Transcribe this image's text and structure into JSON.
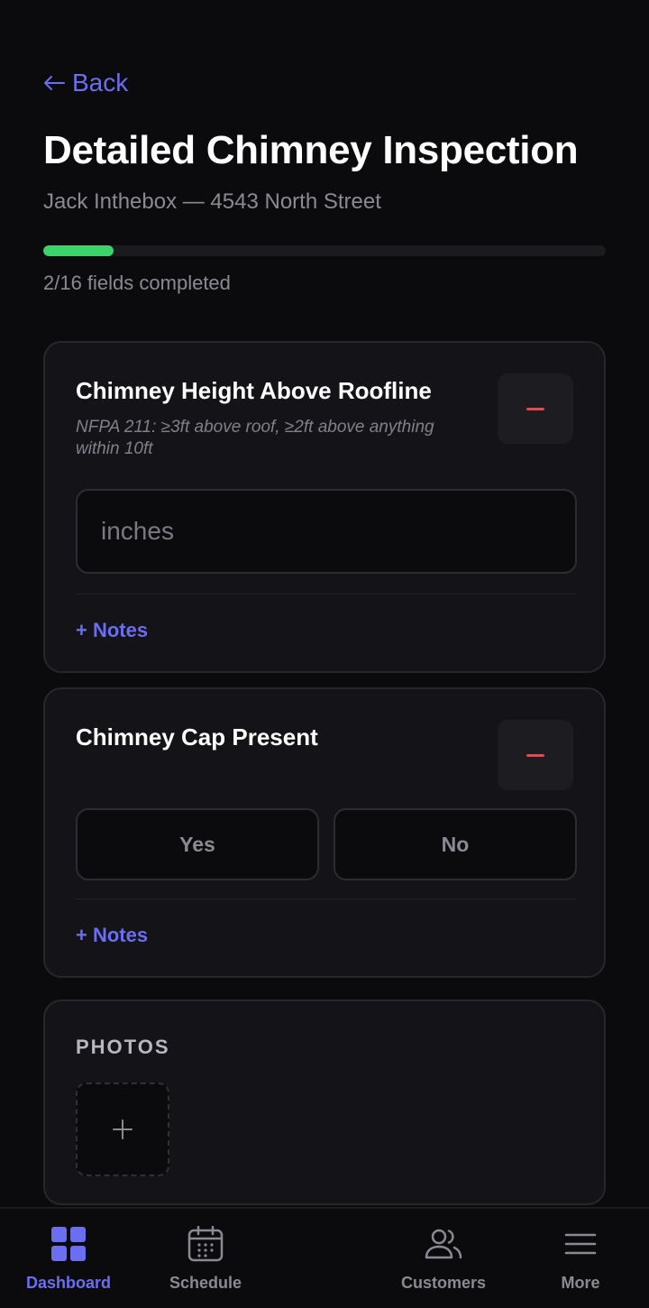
{
  "header": {
    "back_label": "Back",
    "title": "Detailed Chimney Inspection",
    "subtitle": "Jack Inthebox — 4543 North Street"
  },
  "progress": {
    "completed": 2,
    "total": 16,
    "label": "2/16 fields completed",
    "color": "#3dd36a"
  },
  "fields": [
    {
      "title": "Chimney Height Above Roofline",
      "hint": "NFPA 211: ≥3ft above roof, ≥2ft above anything within 10ft",
      "input_placeholder": "inches",
      "input_value": "",
      "notes_label": "+ Notes"
    },
    {
      "title": "Chimney Cap Present",
      "options": [
        "Yes",
        "No"
      ],
      "notes_label": "+ Notes"
    }
  ],
  "photos": {
    "section_label": "PHOTOS",
    "add_icon": "plus"
  },
  "nav": [
    {
      "label": "Dashboard",
      "icon": "dashboard-grid-icon",
      "active": true
    },
    {
      "label": "Schedule",
      "icon": "calendar-icon",
      "active": false
    },
    {
      "label": "Customers",
      "icon": "users-icon",
      "active": false
    },
    {
      "label": "More",
      "icon": "menu-icon",
      "active": false
    }
  ],
  "colors": {
    "accent": "#6b6ef0",
    "background": "#0b0b0e",
    "card": "#141418",
    "danger": "#e5484d",
    "success": "#3dd36a"
  }
}
